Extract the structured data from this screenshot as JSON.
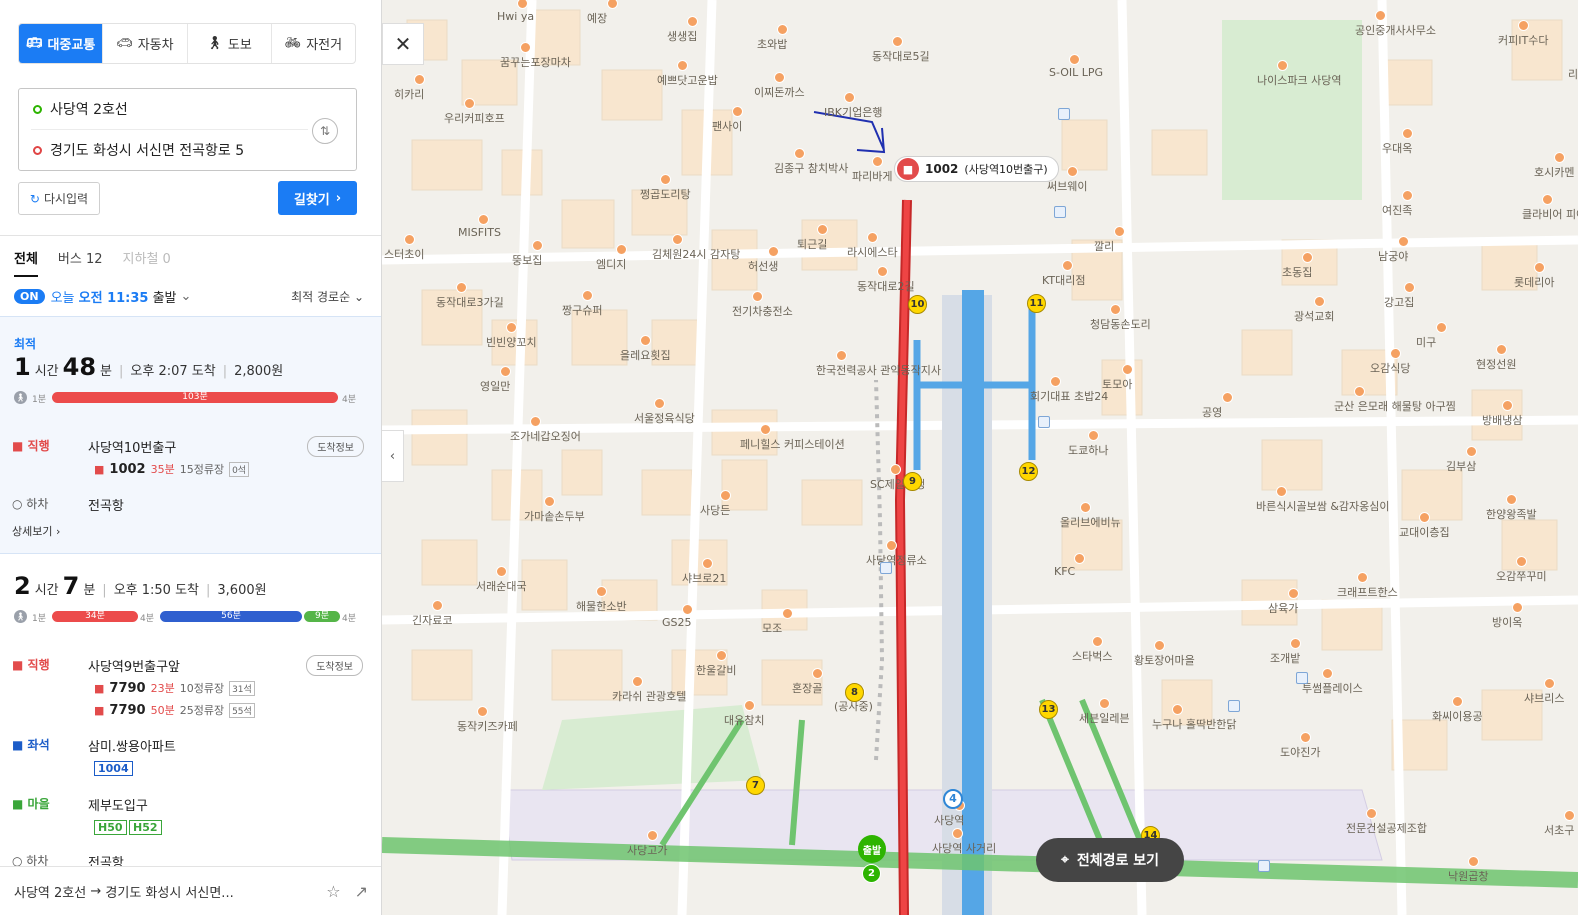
{
  "modes": [
    {
      "label": "대중교통",
      "icon": "bus-icon"
    },
    {
      "label": "자동차",
      "icon": "car-icon"
    },
    {
      "label": "도보",
      "icon": "walk-icon"
    },
    {
      "label": "자전거",
      "icon": "bike-icon"
    }
  ],
  "origin": "사당역 2호선",
  "destination": "경기도 화성시 서신면 전곡항로 5",
  "reinput_label": "다시입력",
  "find_label": "길찾기",
  "tabs": [
    "전체",
    "버스 12",
    "지하철 0"
  ],
  "depart": {
    "on": "ON",
    "prefix": "오늘",
    "time": "오전 11:35",
    "suffix": "출발",
    "sort": "최적 경로순"
  },
  "route1": {
    "badge": "최적",
    "hours": "1",
    "hours_unit": "시간",
    "mins": "48",
    "mins_unit": "분",
    "arrive": "오후 2:07 도착",
    "fare": "2,800원",
    "walk_start": "1분",
    "bus_mins": "103분",
    "walk_end": "4분",
    "step1_label": "직행",
    "step1_station": "사당역10번출구",
    "info_label": "도착정보",
    "bus_no": "1002",
    "bus_eta": "35분",
    "bus_stops": "15정류장",
    "bus_tag": "0석",
    "getoff_label": "하차",
    "getoff_station": "전곡항",
    "detail": "상세보기"
  },
  "route2": {
    "hours": "2",
    "hours_unit": "시간",
    "mins": "7",
    "mins_unit": "분",
    "arrive": "오후 1:50 도착",
    "fare": "3,600원",
    "walk_start": "1분",
    "seg1": "34분",
    "walk_mid": "4분",
    "seg2": "56분",
    "seg3": "9분",
    "walk_end": "4분",
    "step1_label": "직행",
    "step1_station": "사당역9번출구앞",
    "info_label": "도착정보",
    "bus_a_no": "7790",
    "bus_a_eta": "23분",
    "bus_a_stops": "10정류장",
    "bus_a_tag": "31석",
    "bus_b_no": "7790",
    "bus_b_eta": "50분",
    "bus_b_stops": "25정류장",
    "bus_b_tag": "55석",
    "step2_label": "좌석",
    "step2_station": "삼미.쌍용아파트",
    "step2_bus": "1004",
    "step3_label": "마을",
    "step3_station": "제부도입구",
    "step3_bus_a": "H50",
    "step3_bus_b": "H52",
    "step4_label": "하차",
    "step4_station": "전곡항"
  },
  "bottom": {
    "origin": "사당역 2호선",
    "arrow": "→",
    "destination": "경기도 화성시 서신면..."
  },
  "map": {
    "callout_code": "1002",
    "callout_name": "(사당역10번출구)",
    "full_route": "전체경로 보기",
    "start_label": "출발",
    "start_num": "2",
    "metro_num": "4",
    "labels": [
      "Hwi ya",
      "예장",
      "생생집",
      "초와밥",
      "동작대로5길",
      "꿈꾸는포장마차",
      "히카리",
      "예쁘닷고운밥",
      "이찌돈까스",
      "IBK기업은행",
      "S-OIL LPG",
      "나이스파크 사당역",
      "공인중개사사무소",
      "커피IT수다",
      "리에또",
      "우리커피호프",
      "팬사이",
      "김종구 참치박사",
      "파리바게",
      "써브웨이",
      "우대옥",
      "호시카멘",
      "클라비어 피아노",
      "여진족",
      "쩡곱도리탕",
      "MISFITS",
      "퇴근길",
      "라시에스타",
      "깔리",
      "KT대리점",
      "남궁야",
      "강고집",
      "스터초이",
      "뚱보집",
      "엠디지",
      "김체원24시 감자탕",
      "허선생",
      "초동집",
      "광석교회",
      "롯데리아",
      "동작대로2길",
      "짱구슈퍼",
      "전기차충전소",
      "청담동손도리",
      "미구",
      "빈빈양꼬치",
      "을레요횟집",
      "현정선원",
      "오감식당",
      "영일만",
      "토모아",
      "회기대표 초밥24",
      "공영",
      "군산 은모래 해물탕 아구찜",
      "방배냉삼",
      "한국전력공사 관악동작지사",
      "서울정육식당",
      "조가네갑오징어",
      "도쿄하나",
      "페니힐스 커피스테이션",
      "SC제일은행",
      "김부삼",
      "사당든",
      "가마솥손두부",
      "올리브에비뉴",
      "바른식시골보쌈 &감자옹심이",
      "교대이층집",
      "한양왕족발",
      "사당역정류소",
      "샤브로21",
      "KFC",
      "오감쭈꾸미",
      "서래순대국",
      "크래프트한스",
      "삼육가",
      "긴자료코",
      "해물한소반",
      "GS25",
      "모조",
      "방이옥",
      "스타벅스",
      "황토장어마을",
      "조개밭",
      "한울갈비",
      "혼장골",
      "투썸플레이스",
      "카라쉬 관광호텔",
      "(공사중)",
      "세븐일레븐",
      "대유참치",
      "화씨이용공",
      "동작키즈카페",
      "누구나 홀딱반한닭",
      "도야진가",
      "사당고가",
      "사당역",
      "사당역 사거리",
      "전문건설공제조합",
      "서초구 요양병",
      "낙원곱창",
      "샤브리스",
      "동작대로3가길"
    ],
    "stops": [
      "10",
      "11",
      "12",
      "9",
      "8",
      "7",
      "13",
      "14"
    ]
  }
}
